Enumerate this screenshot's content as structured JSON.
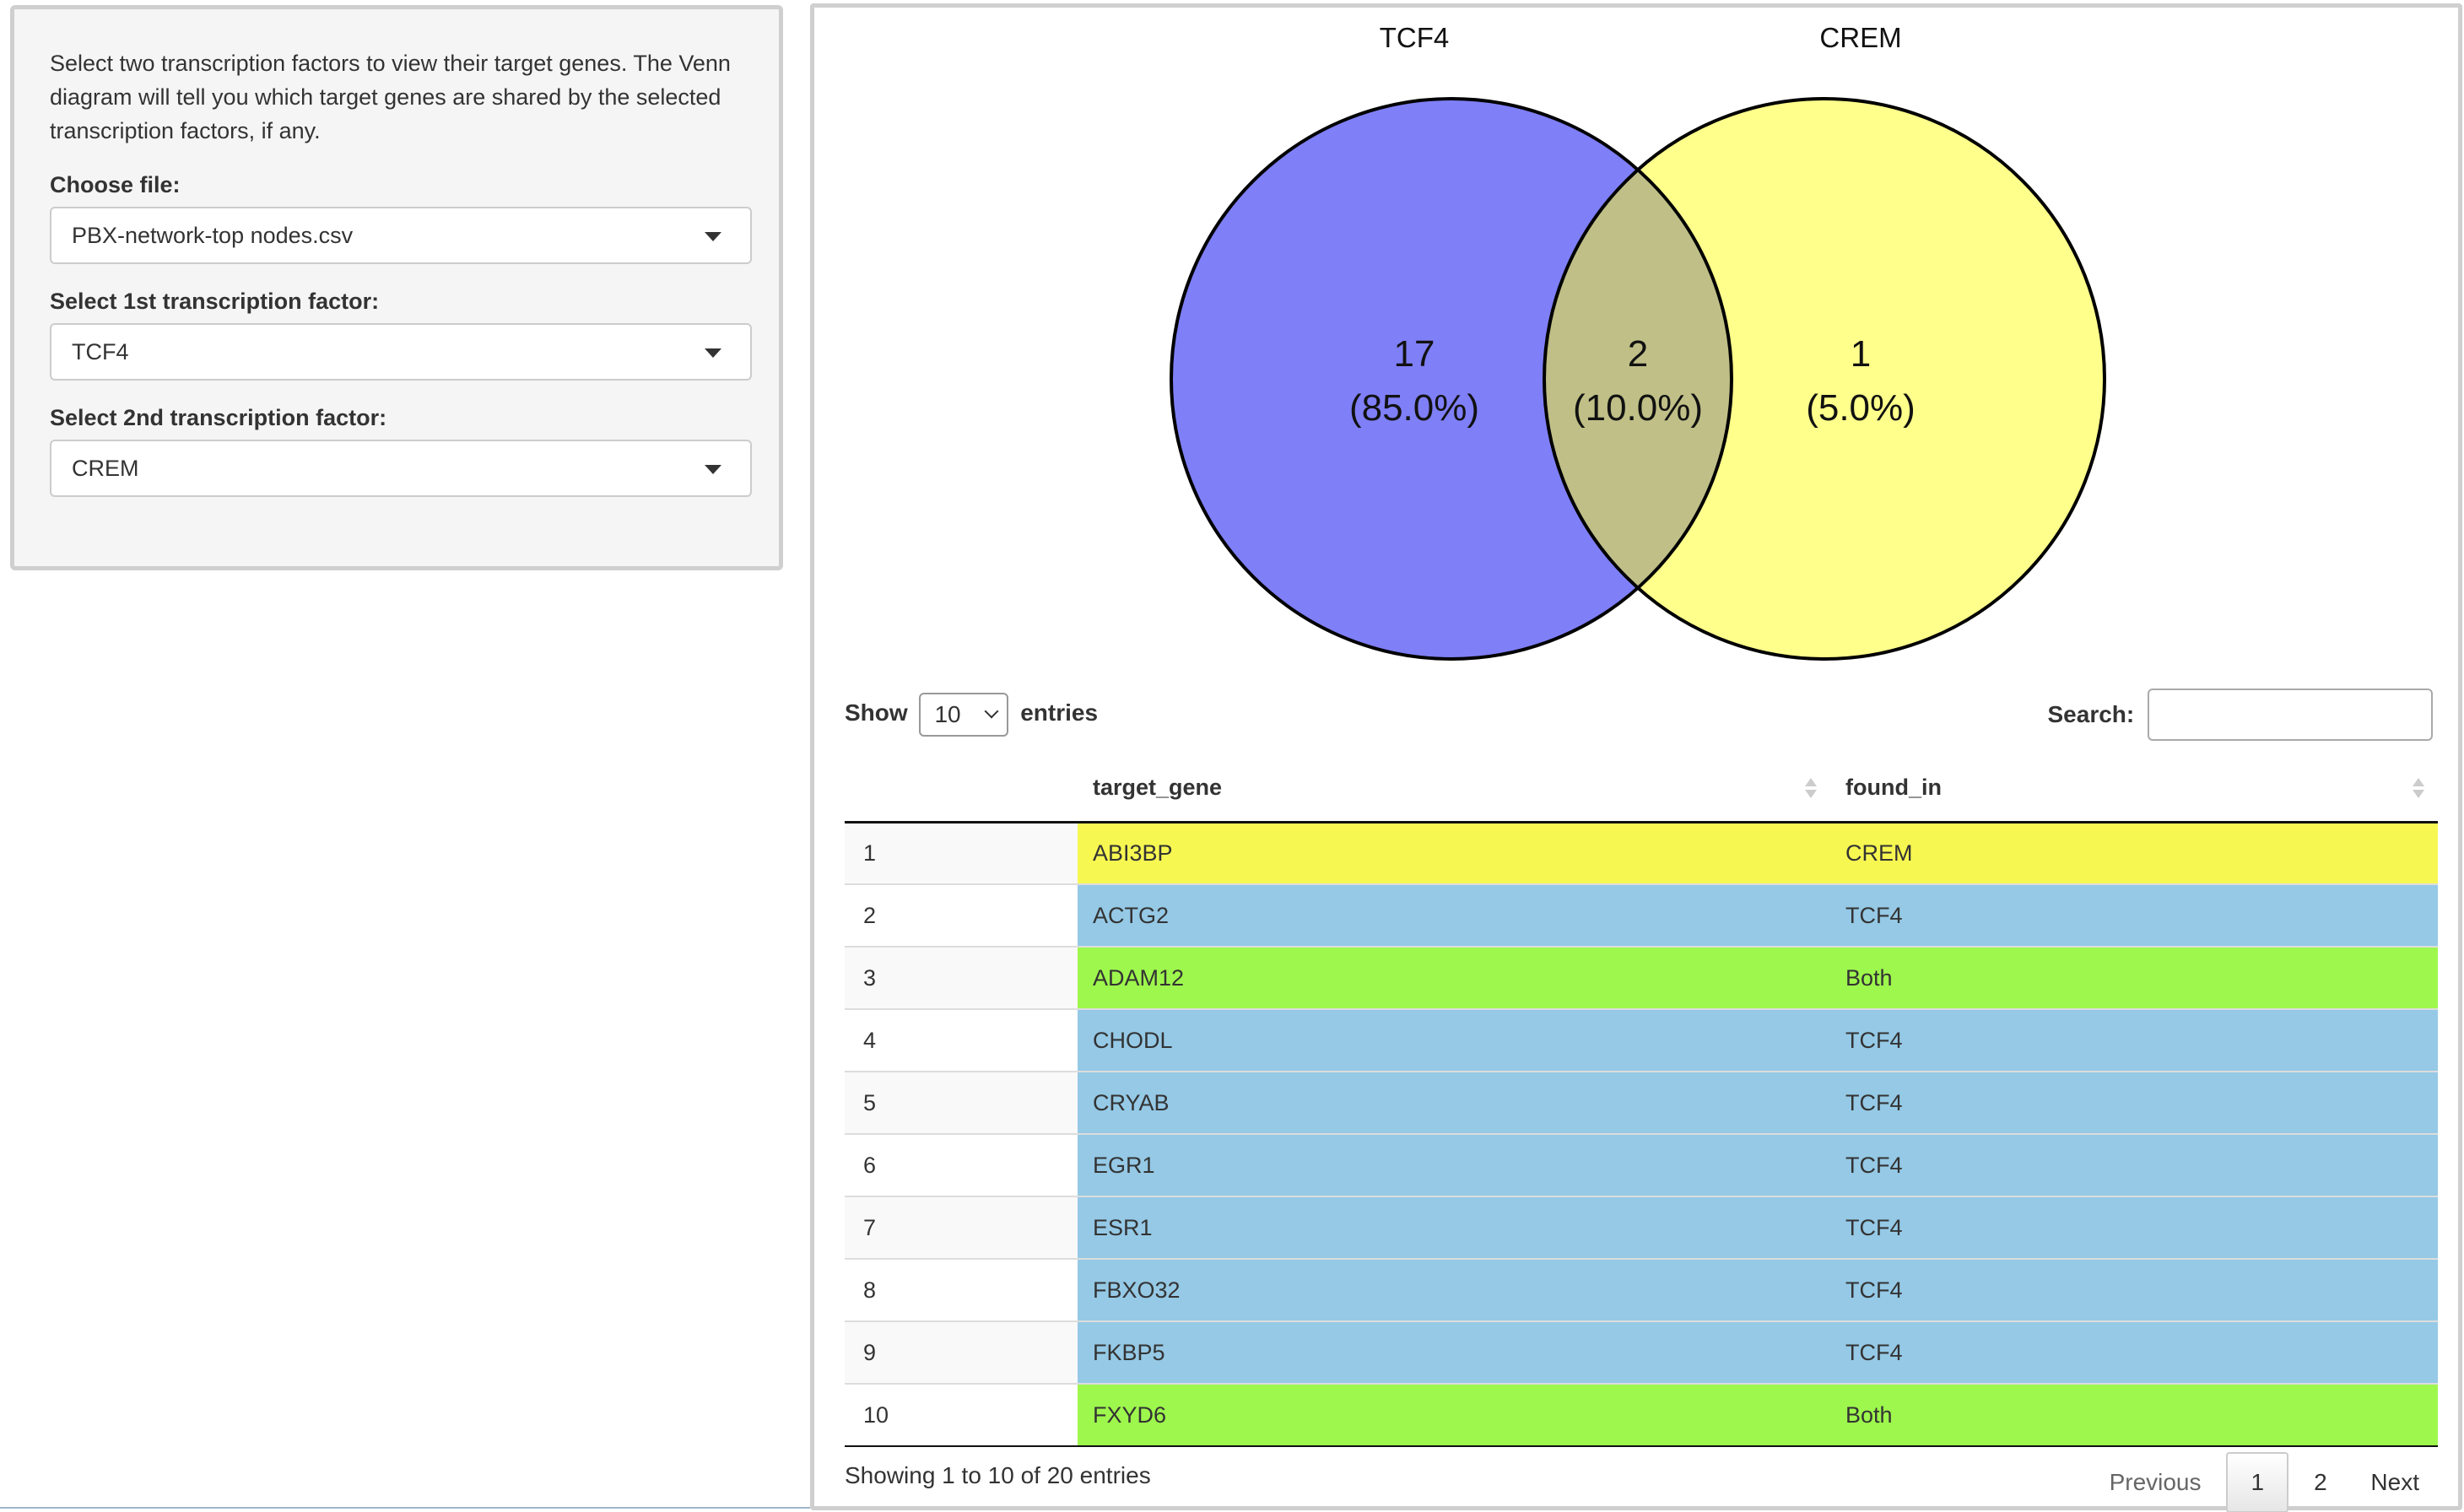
{
  "sidebar": {
    "help_text": "Select two transcription factors to view their target genes. The Venn diagram will tell you which target genes are shared by the selected transcription factors, if any.",
    "file_label": "Choose file:",
    "file_value": "PBX-network-top nodes.csv",
    "tf1_label": "Select 1st transcription factor:",
    "tf1_value": "TCF4",
    "tf2_label": "Select 2nd transcription factor:",
    "tf2_value": "CREM"
  },
  "venn": {
    "left_name": "TCF4",
    "right_name": "CREM",
    "left_count": "17",
    "left_pct": "(85.0%)",
    "both_count": "2",
    "both_pct": "(10.0%)",
    "right_count": "1",
    "right_pct": "(5.0%)",
    "colors": {
      "left": "#7f7ff7",
      "right": "#ffff8c",
      "overlap": "#bfbf87"
    }
  },
  "table": {
    "length_prefix": "Show",
    "length_value": "10",
    "length_suffix": "entries",
    "search_label": "Search:",
    "search_value": "",
    "columns": [
      "",
      "target_gene",
      "found_in"
    ],
    "rows": [
      {
        "idx": "1",
        "gene": "ABI3BP",
        "found": "CREM"
      },
      {
        "idx": "2",
        "gene": "ACTG2",
        "found": "TCF4"
      },
      {
        "idx": "3",
        "gene": "ADAM12",
        "found": "Both"
      },
      {
        "idx": "4",
        "gene": "CHODL",
        "found": "TCF4"
      },
      {
        "idx": "5",
        "gene": "CRYAB",
        "found": "TCF4"
      },
      {
        "idx": "6",
        "gene": "EGR1",
        "found": "TCF4"
      },
      {
        "idx": "7",
        "gene": "ESR1",
        "found": "TCF4"
      },
      {
        "idx": "8",
        "gene": "FBXO32",
        "found": "TCF4"
      },
      {
        "idx": "9",
        "gene": "FKBP5",
        "found": "TCF4"
      },
      {
        "idx": "10",
        "gene": "FXYD6",
        "found": "Both"
      }
    ],
    "row_colors": {
      "CREM": "#f7f752",
      "TCF4": "#95c9e6",
      "Both": "#9ef74d"
    },
    "info": "Showing 1 to 10 of 20 entries",
    "pagination": {
      "previous": "Previous",
      "current": "1",
      "page2": "2",
      "next": "Next"
    }
  }
}
